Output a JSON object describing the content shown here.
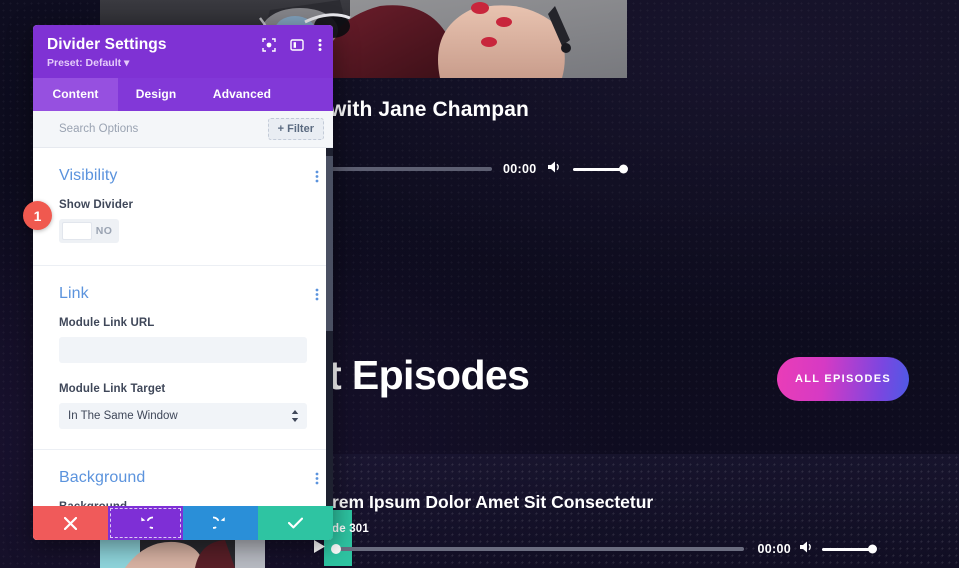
{
  "page": {
    "hero_title": "with Jane Champan",
    "top_player": {
      "time": "00:00",
      "volume_icon": "speaker-icon"
    },
    "episodes_heading": "t Episodes",
    "all_episodes_button": "ALL EPISODES",
    "episode_card": {
      "title": "rem Ipsum Dolor Amet Sit Consectetur",
      "subtitle": "de 301"
    },
    "bottom_player": {
      "play_icon": "play-icon",
      "time": "00:00",
      "volume_icon": "speaker-icon"
    },
    "colors": {
      "background": "#0d0c1d",
      "accent_teal": "#2ec4a2",
      "button_gradient_start": "#ea3db7",
      "button_gradient_end": "#4e5ae6"
    }
  },
  "modal": {
    "title": "Divider Settings",
    "preset": "Preset: Default",
    "header_icons": [
      {
        "name": "focus-icon"
      },
      {
        "name": "layout-panel-icon"
      },
      {
        "name": "kebab-menu-icon"
      }
    ],
    "tabs": [
      {
        "label": "Content",
        "active": true
      },
      {
        "label": "Design",
        "active": false
      },
      {
        "label": "Advanced",
        "active": false
      }
    ],
    "search": {
      "placeholder": "Search Options",
      "value": ""
    },
    "filter_button": "+ Filter",
    "sections": [
      {
        "title": "Visibility",
        "fields": [
          {
            "label": "Show Divider",
            "type": "toggle",
            "value": "NO"
          }
        ]
      },
      {
        "title": "Link",
        "fields": [
          {
            "label": "Module Link URL",
            "type": "text",
            "value": "",
            "placeholder": ""
          },
          {
            "label": "Module Link Target",
            "type": "select",
            "value": "In The Same Window"
          }
        ]
      },
      {
        "title": "Background",
        "fields": [
          {
            "label": "Background",
            "type": "background-tabs",
            "value": ""
          }
        ]
      }
    ],
    "actions": [
      {
        "name": "cancel-button",
        "icon": "close-icon",
        "color": "#f05a5a"
      },
      {
        "name": "undo-button",
        "icon": "undo-icon",
        "color": "#7e2fd6"
      },
      {
        "name": "redo-button",
        "icon": "redo-icon",
        "color": "#2a8fd8"
      },
      {
        "name": "save-button",
        "icon": "check-icon",
        "color": "#2ec4a2"
      }
    ],
    "colors": {
      "header": "#7f32d4",
      "tab_active": "#9650e0",
      "section_title": "#5b93dd"
    }
  },
  "annotation": {
    "step_number": "1"
  }
}
